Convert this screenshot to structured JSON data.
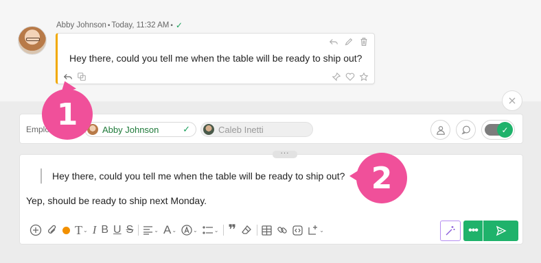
{
  "message": {
    "author": "Abby Johnson",
    "timestamp": "Today, 11:32 AM",
    "text": "Hey there, could you tell me when the table will be ready to ship out?"
  },
  "recipients": {
    "label": "Emplo",
    "chips": [
      {
        "name": "Abby Johnson",
        "selected": true
      },
      {
        "name": "Caleb Inetti",
        "selected": false
      }
    ]
  },
  "composer": {
    "quoted_text": "Hey there, could you tell me when the table will be ready to ship out?",
    "reply_text": "Yep, should be ready to ship next Monday.",
    "more_label": "•••"
  },
  "callouts": [
    "1",
    "2"
  ],
  "colors": {
    "accent_green": "#1fb26b",
    "callout_pink": "#f0509a",
    "message_bar": "#f2a900",
    "text_color_dot": "#f29000"
  }
}
